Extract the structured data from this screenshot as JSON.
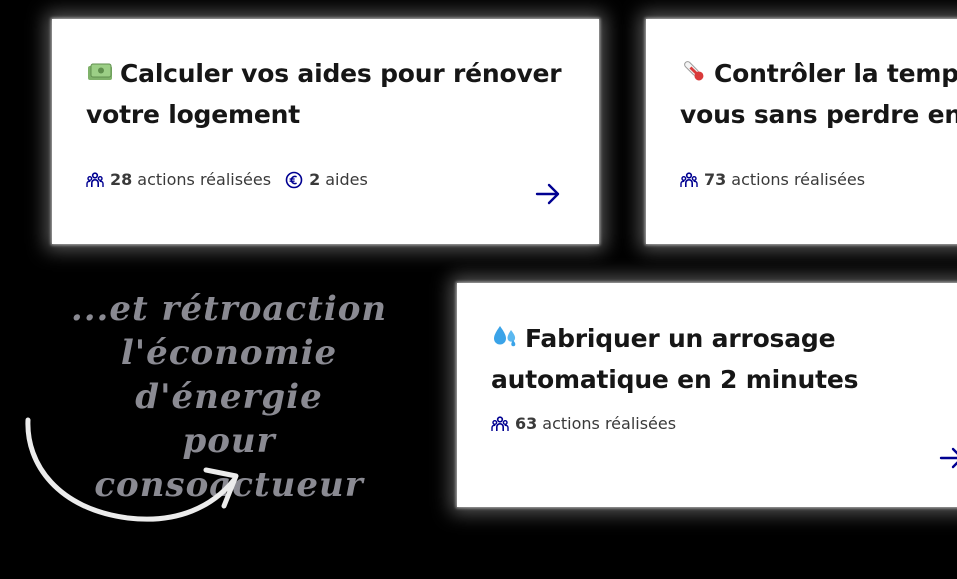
{
  "cards": [
    {
      "title_lines": [
        "Calculer vos aides pour rénover",
        "votre logement"
      ],
      "emoji_icon": "money-bills-icon",
      "actions_count": "28",
      "actions_label": "actions réalisées",
      "aides_count": "2",
      "aides_label": "aides"
    },
    {
      "title_lines": [
        "Contrôler la temp",
        "vous sans perdre en"
      ],
      "emoji_icon": "thermometer-icon",
      "actions_count": "73",
      "actions_label": "actions réalisées"
    },
    {
      "title_lines": [
        "Fabriquer un arrosage",
        "automatique en 2 minutes"
      ],
      "emoji_icon": "water-droplets-icon",
      "actions_count": "63",
      "actions_label": "actions réalisées"
    }
  ],
  "side_note": {
    "lines": [
      "...et rétroaction",
      "l'économie d'énergie",
      "pour consoactueur"
    ]
  },
  "colors": {
    "background": "#000000",
    "card": "#ffffff",
    "title": "#161616",
    "accent": "#000091",
    "note": "#8a8a92"
  }
}
